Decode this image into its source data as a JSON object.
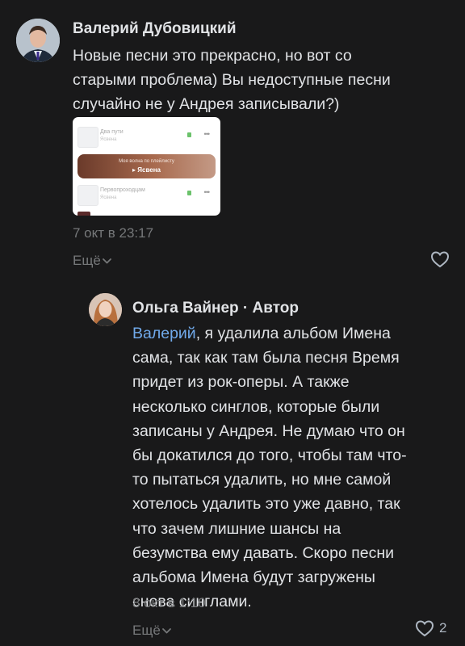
{
  "comments": [
    {
      "author": "Валерий Дубовицкий",
      "lines": [
        "Новые песни это прекрасно, но вот со",
        "старыми проблема) Вы недоступные песни",
        "случайно не у Андрея записывали?)"
      ],
      "attachment": {
        "rows": [
          {
            "title": "Два пути",
            "artist": "Ясвена"
          },
          {
            "title": "Первопроходцам",
            "artist": "Ясвена"
          }
        ],
        "wave_caption": "Моя волна по плейлисту",
        "wave_play": "▸ Ясвена",
        "dots": "•••"
      },
      "date": "7 окт в 23:17",
      "more": "Ещё",
      "likes": ""
    },
    {
      "author": "Ольга Вайнер",
      "role": " · Автор",
      "mention": "Валерий",
      "first_line_rest": ", я удалила альбом Имена",
      "lines": [
        "сама, так как там была песня Время",
        "придет из рок-оперы. А также",
        "несколько синглов, которые были",
        "записаны у Андрея. Не думаю что он",
        "бы докатился до того, чтобы там что-",
        "то пытаться удалить, но мне самой",
        "хотелось удалить это уже давно, так",
        "что зачем лишние шансы на",
        "безумства ему давать. Скоро песни",
        "альбома Имена будут загружены",
        "снова синглами."
      ],
      "date": "8 окт в 1:10",
      "more": "Ещё",
      "likes": "2"
    }
  ],
  "colors": {
    "background": "#19191a",
    "text": "#e1e3e6",
    "secondary": "#76787a",
    "mention": "#71aaeb"
  }
}
